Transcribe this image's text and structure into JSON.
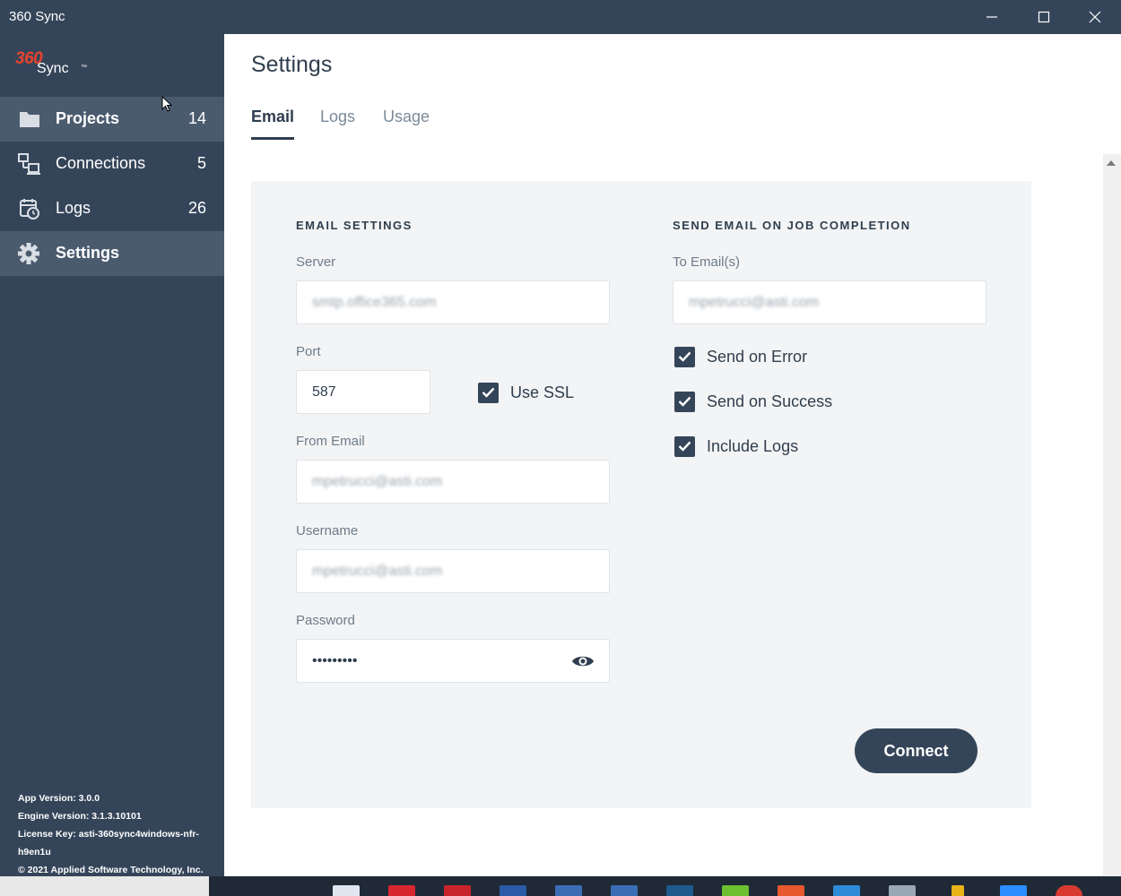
{
  "window": {
    "title": "360 Sync"
  },
  "logo": {
    "brand_number": "360",
    "brand_name": "Sync",
    "trademark": "™",
    "accent_color": "#e8432e"
  },
  "sidebar": {
    "items": [
      {
        "label": "Projects",
        "count": "14",
        "icon": "folder-icon"
      },
      {
        "label": "Connections",
        "count": "5",
        "icon": "network-icon"
      },
      {
        "label": "Logs",
        "count": "26",
        "icon": "calendar-clock-icon"
      },
      {
        "label": "Settings",
        "count": "",
        "icon": "gear-icon"
      }
    ],
    "footer": {
      "app_version": "App Version: 3.0.0",
      "engine_version": "Engine Version: 3.1.3.10101",
      "license_key": "License Key: asti-360sync4windows-nfr-h9en1u",
      "copyright": "© 2021 Applied Software Technology, Inc."
    }
  },
  "main": {
    "title": "Settings",
    "tabs": [
      {
        "label": "Email"
      },
      {
        "label": "Logs"
      },
      {
        "label": "Usage"
      }
    ]
  },
  "email_settings": {
    "heading": "EMAIL SETTINGS",
    "server_label": "Server",
    "server_value": "smtp.office365.com",
    "port_label": "Port",
    "port_value": "587",
    "use_ssl_label": "Use SSL",
    "use_ssl_checked": true,
    "from_email_label": "From Email",
    "from_email_value": "mpetrucci@asti.com",
    "username_label": "Username",
    "username_value": "mpetrucci@asti.com",
    "password_label": "Password",
    "password_value": "•••••••••"
  },
  "job_completion": {
    "heading": "SEND EMAIL ON JOB COMPLETION",
    "to_label": "To Email(s)",
    "to_value": "mpetrucci@asti.com",
    "options": [
      {
        "label": "Send on Error",
        "checked": true
      },
      {
        "label": "Send on Success",
        "checked": true
      },
      {
        "label": "Include Logs",
        "checked": true
      }
    ]
  },
  "actions": {
    "connect_label": "Connect"
  },
  "colors": {
    "sidebar": "#354559",
    "sidebar_active": "#4b5b6e",
    "primary_button": "#354559",
    "panel": "#f3f4f5"
  }
}
